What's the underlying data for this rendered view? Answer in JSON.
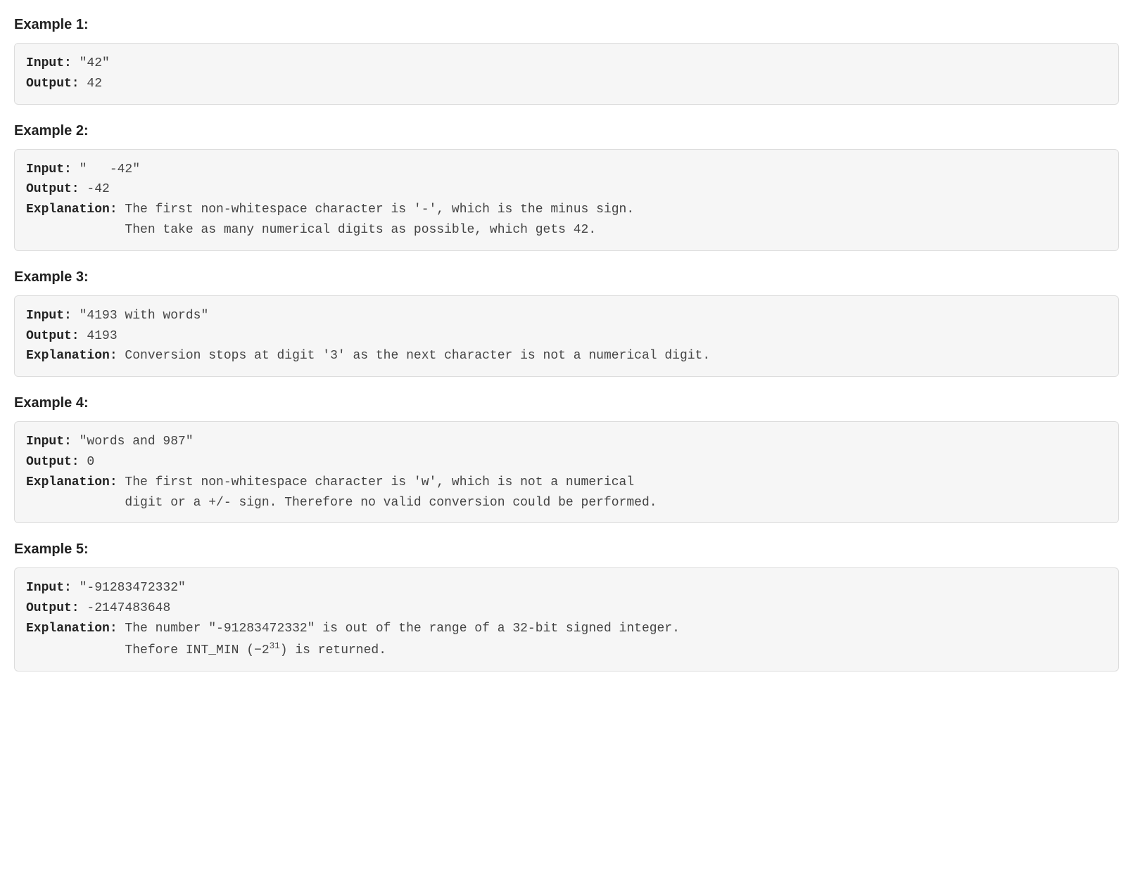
{
  "labels": {
    "input": "Input:",
    "output": "Output:",
    "explanation": "Explanation:"
  },
  "examples": [
    {
      "heading": "Example 1:",
      "input": " \"42\"",
      "output": " 42",
      "explanation_lines": []
    },
    {
      "heading": "Example 2:",
      "input": " \"   -42\"",
      "output": " -42",
      "explanation_lines": [
        " The first non-whitespace character is '-', which is the minus sign.",
        "             Then take as many numerical digits as possible, which gets 42."
      ]
    },
    {
      "heading": "Example 3:",
      "input": " \"4193 with words\"",
      "output": " 4193",
      "explanation_lines": [
        " Conversion stops at digit '3' as the next character is not a numerical digit."
      ]
    },
    {
      "heading": "Example 4:",
      "input": " \"words and 987\"",
      "output": " 0",
      "explanation_lines": [
        " The first non-whitespace character is 'w', which is not a numerical ",
        "             digit or a +/- sign. Therefore no valid conversion could be performed."
      ]
    },
    {
      "heading": "Example 5:",
      "input": " \"-91283472332\"",
      "output": " -2147483648",
      "explanation_lines": [
        " The number \"-91283472332\" is out of the range of a 32-bit signed integer.",
        "             Thefore INT_MIN (−2",
        ") is returned."
      ],
      "superscript_after_line": 1,
      "superscript": "31"
    }
  ]
}
